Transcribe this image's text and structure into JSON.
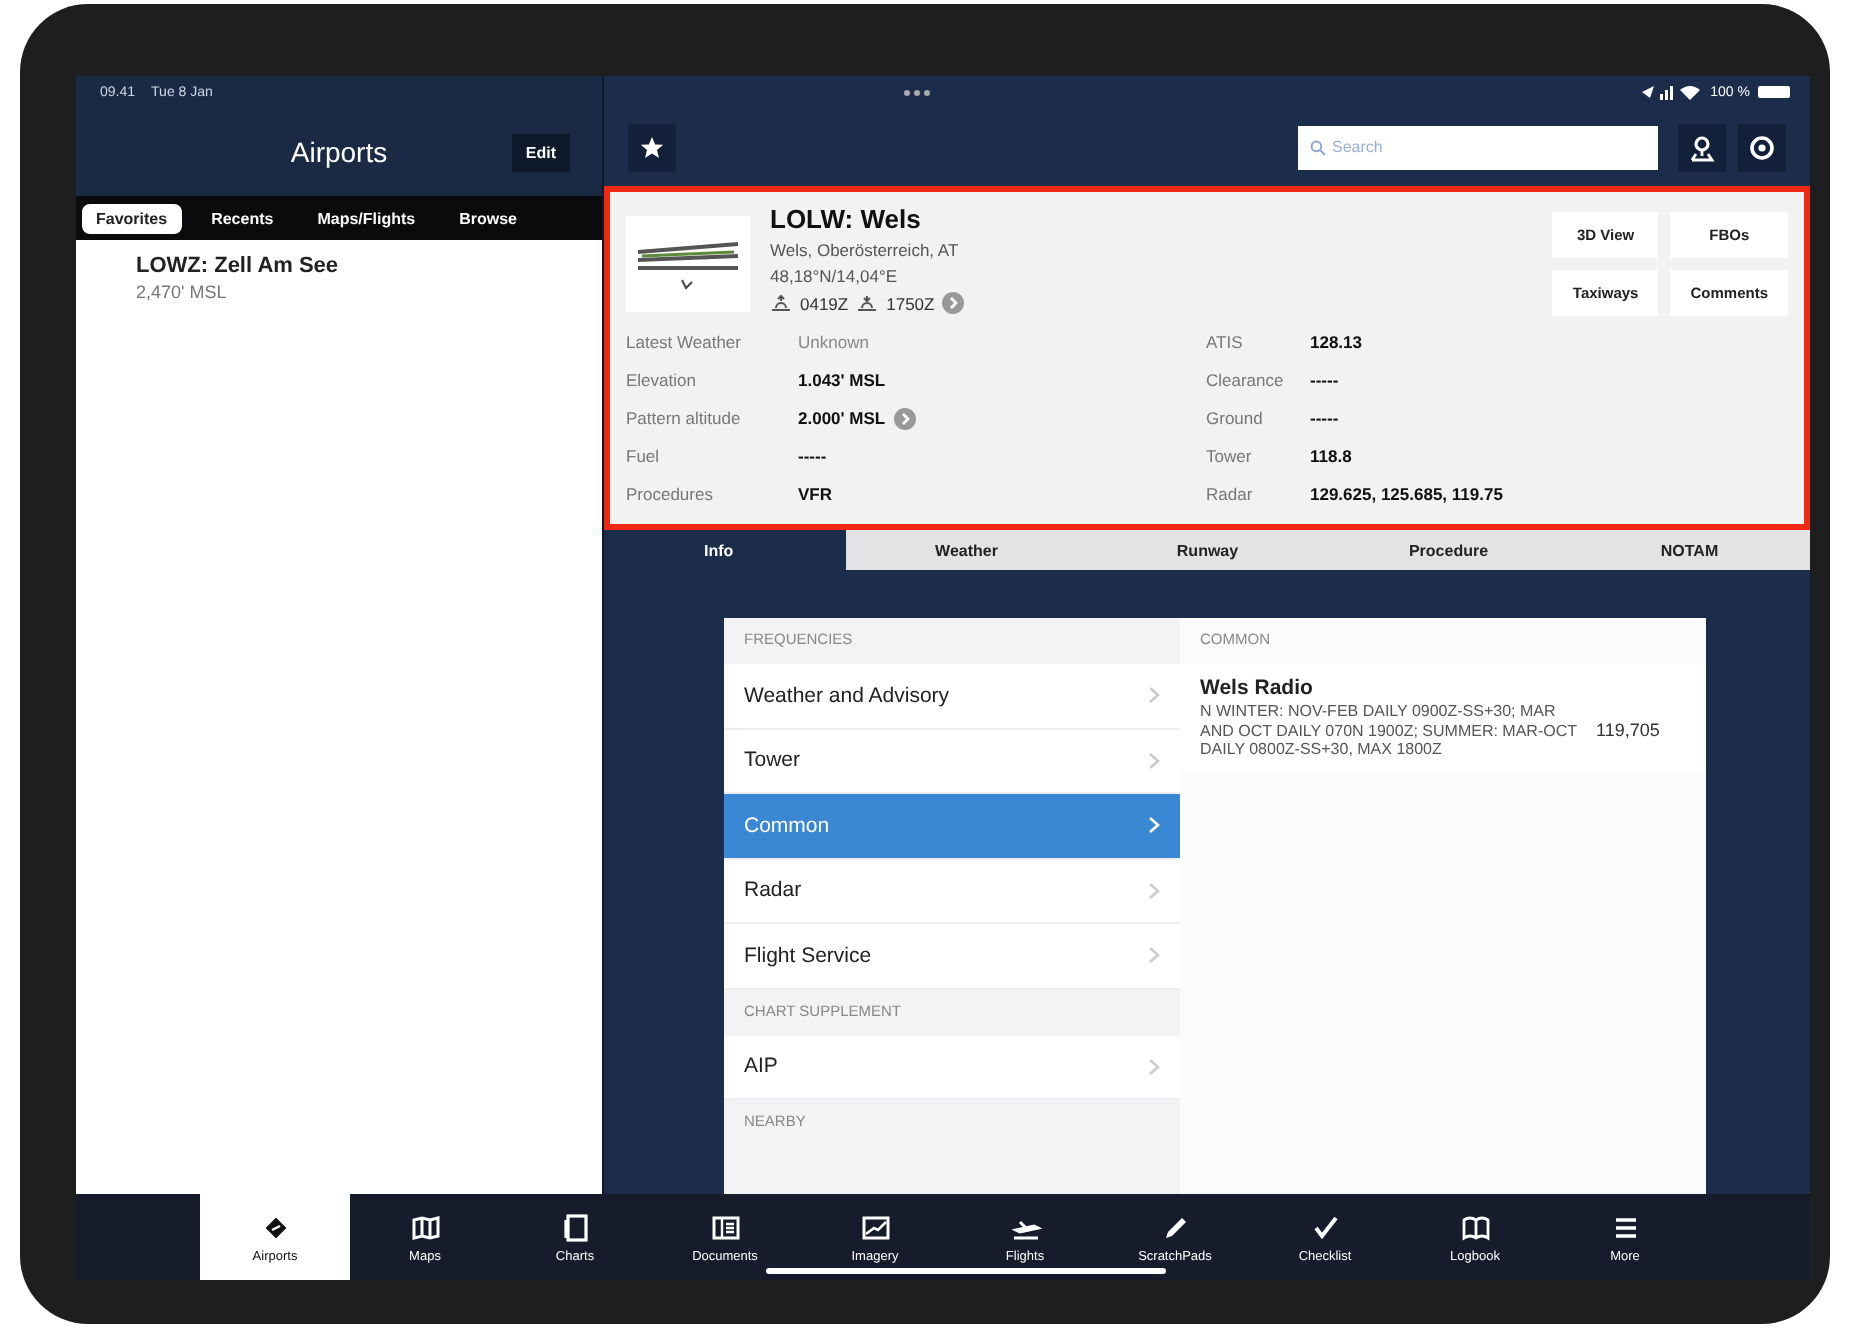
{
  "status_bar": {
    "time": "09.41",
    "date": "Tue 8 Jan",
    "battery": "100 %"
  },
  "sidebar": {
    "title": "Airports",
    "edit_button": "Edit",
    "segments": [
      {
        "label": "Favorites",
        "selected": true
      },
      {
        "label": "Recents",
        "selected": false
      },
      {
        "label": "Maps/Flights",
        "selected": false
      },
      {
        "label": "Browse",
        "selected": false
      }
    ],
    "items": [
      {
        "title": "LOWZ: Zell Am See",
        "subtitle": "2,470' MSL"
      }
    ]
  },
  "toolbar": {
    "search": {
      "placeholder": "Search"
    }
  },
  "airport": {
    "highlighted": true,
    "title": "LOLW: Wels",
    "location": "Wels, Oberösterreich, AT",
    "coordinates": "48,18°N/14,04°E",
    "sunrise": "0419Z",
    "sunset": "1750Z",
    "buttons": [
      "3D View",
      "FBOs",
      "Taxiways",
      "Comments"
    ],
    "left_fields": [
      {
        "label": "Latest Weather",
        "value": "Unknown",
        "muted": true,
        "link": false
      },
      {
        "label": "Elevation",
        "value": "1.043' MSL",
        "muted": false,
        "link": false
      },
      {
        "label": "Pattern altitude",
        "value": "2.000' MSL",
        "muted": false,
        "link": true
      },
      {
        "label": "Fuel",
        "value": "-----",
        "muted": false,
        "link": false
      },
      {
        "label": "Procedures",
        "value": "VFR",
        "muted": false,
        "link": false
      }
    ],
    "right_fields": [
      {
        "label": "ATIS",
        "value": "128.13"
      },
      {
        "label": "Clearance",
        "value": "-----"
      },
      {
        "label": "Ground",
        "value": "-----"
      },
      {
        "label": "Tower",
        "value": "118.8"
      },
      {
        "label": "Radar",
        "value": "129.625, 125.685, 119.75"
      }
    ]
  },
  "tabs": [
    {
      "label": "Info",
      "selected": true
    },
    {
      "label": "Weather",
      "selected": false
    },
    {
      "label": "Runway",
      "selected": false
    },
    {
      "label": "Procedure",
      "selected": false
    },
    {
      "label": "NOTAM",
      "selected": false
    }
  ],
  "frequencies": [
    {
      "kind": "header",
      "label": "FREQUENCIES"
    },
    {
      "kind": "item",
      "label": "Weather and Advisory",
      "selected": false
    },
    {
      "kind": "item",
      "label": "Tower",
      "selected": false
    },
    {
      "kind": "item",
      "label": "Common",
      "selected": true
    },
    {
      "kind": "item",
      "label": "Radar",
      "selected": false
    },
    {
      "kind": "item",
      "label": "Flight Service",
      "selected": false
    },
    {
      "kind": "header",
      "label": "CHART SUPPLEMENT"
    },
    {
      "kind": "item",
      "label": "AIP",
      "selected": false
    },
    {
      "kind": "header",
      "label": "NEARBY"
    }
  ],
  "detail": {
    "heading": "COMMON",
    "name": "Wels Radio",
    "remarks": "N  WINTER: NOV-FEB DAILY 0900Z-SS+30;  MAR AND OCT DAILY 070N 1900Z; SUMMER: MAR-OCT DAILY 0800Z-SS+30, MAX 1800Z",
    "frequency": "119,705"
  },
  "tab_bar": [
    {
      "kind": "airports",
      "label": "Airports",
      "selected": true
    },
    {
      "kind": "maps",
      "label": "Maps",
      "selected": false
    },
    {
      "kind": "charts",
      "label": "Charts",
      "selected": false
    },
    {
      "kind": "documents",
      "label": "Documents",
      "selected": false
    },
    {
      "kind": "imagery",
      "label": "Imagery",
      "selected": false
    },
    {
      "kind": "flights",
      "label": "Flights",
      "selected": false
    },
    {
      "kind": "scratchpads",
      "label": "ScratchPads",
      "selected": false
    },
    {
      "kind": "checklist",
      "label": "Checklist",
      "selected": false
    },
    {
      "kind": "logbook",
      "label": "Logbook",
      "selected": false
    },
    {
      "kind": "more",
      "label": "More",
      "selected": false
    }
  ]
}
